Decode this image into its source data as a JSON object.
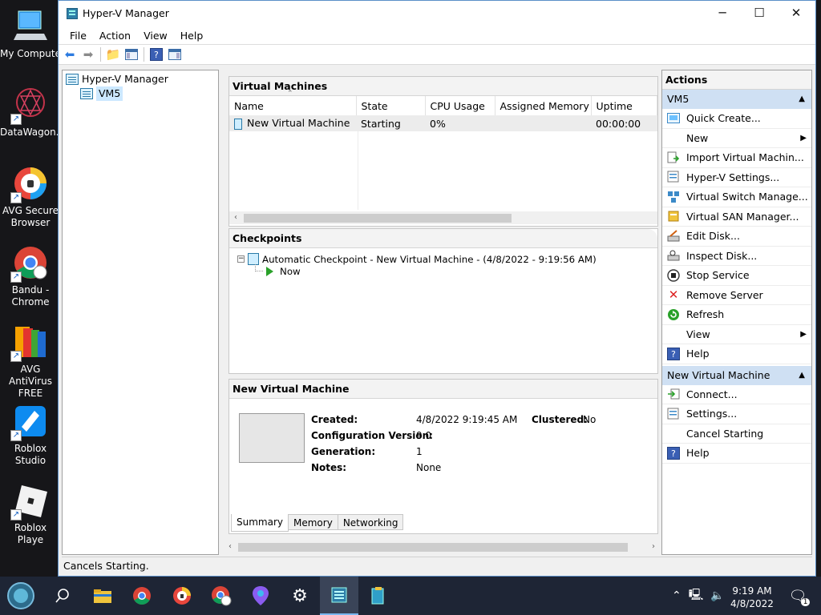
{
  "desktop": {
    "icons": [
      {
        "label": "My Compute",
        "icon": "computer-icon"
      },
      {
        "label": "DataWagon...",
        "icon": "datawagon-icon"
      },
      {
        "label": "AVG Secure Browser",
        "icon": "avg-secure-browser-icon"
      },
      {
        "label": "Bandu - Chrome",
        "icon": "chrome-icon"
      },
      {
        "label": "AVG AntiVirus FREE",
        "icon": "avg-antivirus-icon"
      },
      {
        "label": "Roblox Studio",
        "icon": "roblox-studio-icon"
      },
      {
        "label": "Roblox Playe",
        "icon": "roblox-player-icon"
      }
    ]
  },
  "window": {
    "title": "Hyper-V Manager",
    "controls": {
      "minimize": "─",
      "maximize": "☐",
      "close": "✕"
    }
  },
  "menu": [
    "File",
    "Action",
    "View",
    "Help"
  ],
  "tree": {
    "root": "Hyper-V Manager",
    "server": "VM5"
  },
  "vms": {
    "heading": "Virtual Machines",
    "columns": [
      "Name",
      "State",
      "CPU Usage",
      "Assigned Memory",
      "Uptime"
    ],
    "rows": [
      {
        "name": "New Virtual Machine",
        "state": "Starting",
        "cpu": "0%",
        "memory": "",
        "uptime": "00:00:00"
      }
    ]
  },
  "checkpoints": {
    "heading": "Checkpoints",
    "item": "Automatic Checkpoint - New Virtual Machine - (4/8/2022 - 9:19:56 AM)",
    "now": "Now"
  },
  "details": {
    "heading": "New Virtual Machine",
    "created_label": "Created:",
    "created_value": "4/8/2022 9:19:45 AM",
    "clustered_label": "Clustered:",
    "clustered_value": "No",
    "config_label": "Configuration Version:",
    "config_value": "9.0",
    "generation_label": "Generation:",
    "generation_value": "1",
    "notes_label": "Notes:",
    "notes_value": "None",
    "tabs": [
      "Summary",
      "Memory",
      "Networking"
    ]
  },
  "actions": {
    "heading": "Actions",
    "server_group": "VM5",
    "server_items": [
      {
        "label": "Quick Create...",
        "icon": "quick-create-icon"
      },
      {
        "label": "New",
        "icon": "",
        "submenu": true
      },
      {
        "label": "Import Virtual Machin...",
        "icon": "import-icon"
      },
      {
        "label": "Hyper-V Settings...",
        "icon": "settings-icon"
      },
      {
        "label": "Virtual Switch Manage...",
        "icon": "switch-icon"
      },
      {
        "label": "Virtual SAN Manager...",
        "icon": "san-icon"
      },
      {
        "label": "Edit Disk...",
        "icon": "edit-disk-icon"
      },
      {
        "label": "Inspect Disk...",
        "icon": "inspect-disk-icon"
      },
      {
        "label": "Stop Service",
        "icon": "stop-icon"
      },
      {
        "label": "Remove Server",
        "icon": "remove-icon"
      },
      {
        "label": "Refresh",
        "icon": "refresh-icon"
      },
      {
        "label": "View",
        "icon": "",
        "submenu": true
      },
      {
        "label": "Help",
        "icon": "help-icon"
      }
    ],
    "vm_group": "New Virtual Machine",
    "vm_items": [
      {
        "label": "Connect...",
        "icon": "connect-icon"
      },
      {
        "label": "Settings...",
        "icon": "settings-icon"
      },
      {
        "label": "Cancel Starting",
        "icon": ""
      },
      {
        "label": "Help",
        "icon": "help-icon"
      }
    ]
  },
  "status": "Cancels Starting.",
  "taskbar": {
    "time": "9:19 AM",
    "date": "4/8/2022",
    "notification_count": "1"
  }
}
